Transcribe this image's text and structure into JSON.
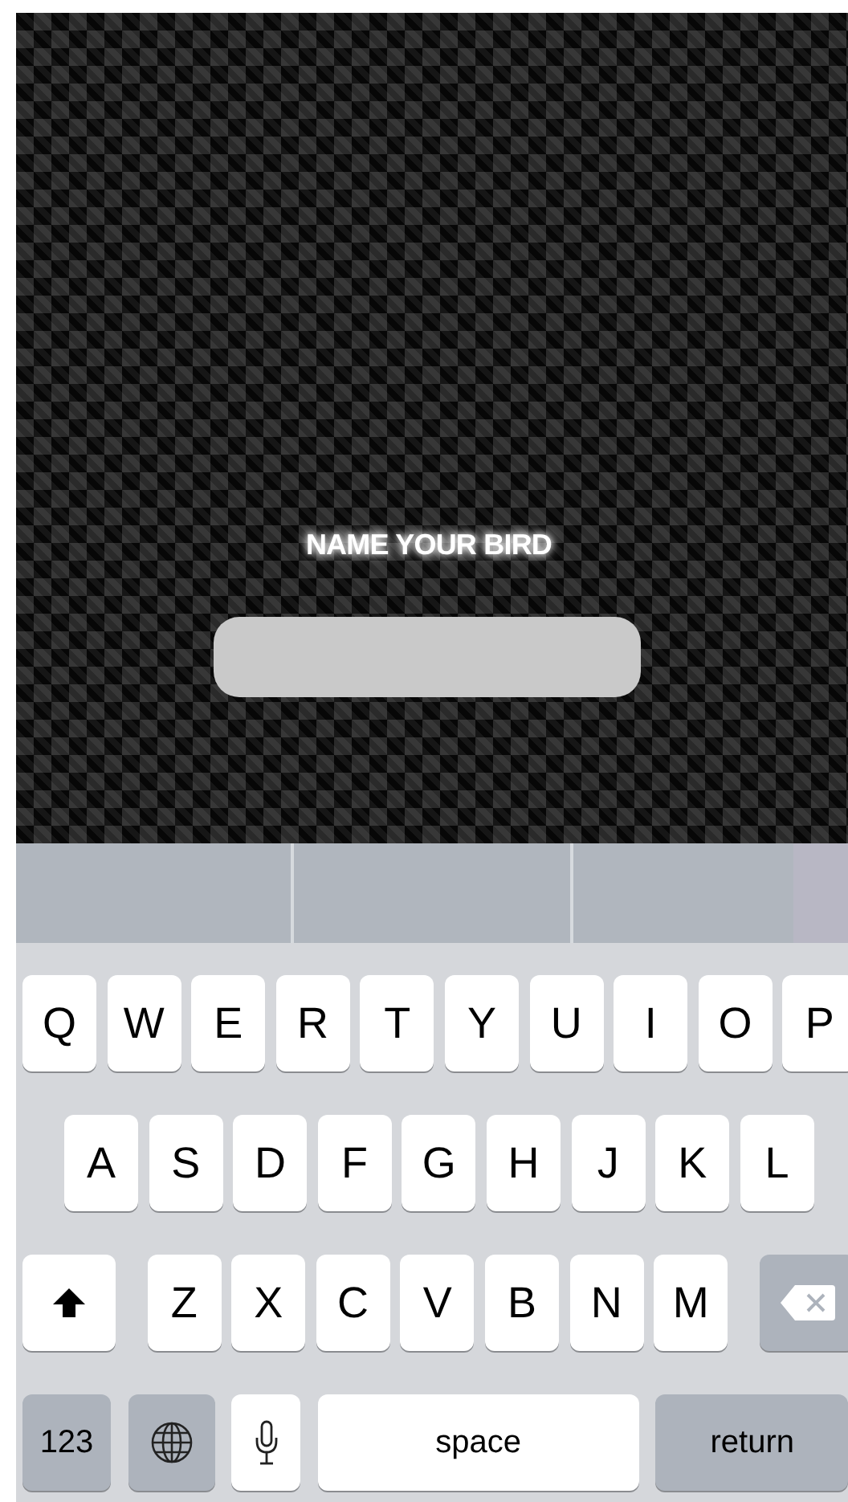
{
  "prompt": {
    "title": "NAME YOUR BIRD"
  },
  "keyboard": {
    "letter_rows": [
      {
        "keys": [
          {
            "kind": "letter",
            "label": "Q"
          },
          {
            "kind": "letter",
            "label": "W"
          },
          {
            "kind": "letter",
            "label": "E"
          },
          {
            "kind": "letter",
            "label": "R"
          },
          {
            "kind": "letter",
            "label": "T"
          },
          {
            "kind": "letter",
            "label": "Y"
          },
          {
            "kind": "letter",
            "label": "U"
          },
          {
            "kind": "letter",
            "label": "I"
          },
          {
            "kind": "letter",
            "label": "O"
          },
          {
            "kind": "letter",
            "label": "P"
          }
        ]
      },
      {
        "keys": [
          {
            "kind": "letter",
            "label": "A"
          },
          {
            "kind": "letter",
            "label": "S"
          },
          {
            "kind": "letter",
            "label": "D"
          },
          {
            "kind": "letter",
            "label": "F"
          },
          {
            "kind": "letter",
            "label": "G"
          },
          {
            "kind": "letter",
            "label": "H"
          },
          {
            "kind": "letter",
            "label": "J"
          },
          {
            "kind": "letter",
            "label": "K"
          },
          {
            "kind": "letter",
            "label": "L"
          }
        ]
      },
      {
        "keys": [
          {
            "kind": "shift"
          },
          {
            "kind": "letter",
            "label": "Z"
          },
          {
            "kind": "letter",
            "label": "X"
          },
          {
            "kind": "letter",
            "label": "C"
          },
          {
            "kind": "letter",
            "label": "V"
          },
          {
            "kind": "letter",
            "label": "B"
          },
          {
            "kind": "letter",
            "label": "N"
          },
          {
            "kind": "letter",
            "label": "M"
          },
          {
            "kind": "delete"
          }
        ]
      }
    ],
    "bottom_row": {
      "keys": [
        {
          "kind": "numbers",
          "label": "123"
        },
        {
          "kind": "globe"
        },
        {
          "kind": "mic"
        },
        {
          "kind": "space",
          "label": "space"
        },
        {
          "kind": "return",
          "label": "return"
        }
      ]
    }
  }
}
